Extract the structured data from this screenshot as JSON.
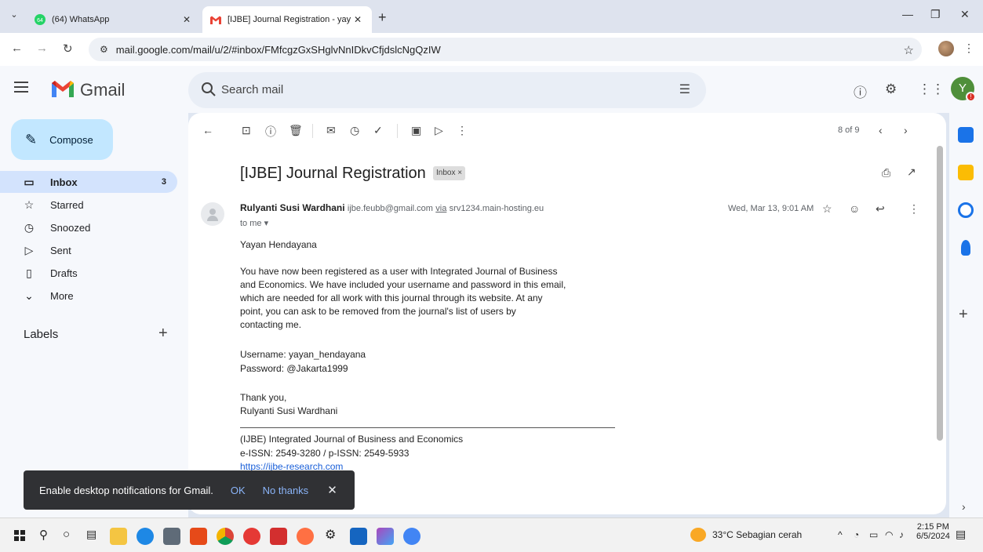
{
  "browser": {
    "tabs": [
      {
        "title": "(64) WhatsApp",
        "badge": "64",
        "active": false
      },
      {
        "title": "[IJBE] Journal Registration - yay",
        "active": true
      }
    ],
    "url_site_icon": "site-settings-icon",
    "url": "mail.google.com/mail/u/2/#inbox/FMfcgzGxSHglvNnIDkvCfjdslcNgQzIW"
  },
  "gmail": {
    "app_name": "Gmail",
    "search_placeholder": "Search mail",
    "avatar_letter": "Y",
    "compose_label": "Compose",
    "nav": [
      {
        "label": "Inbox",
        "count": "3",
        "icon": "inbox-icon"
      },
      {
        "label": "Starred",
        "count": "",
        "icon": "star-icon"
      },
      {
        "label": "Snoozed",
        "count": "",
        "icon": "clock-icon"
      },
      {
        "label": "Sent",
        "count": "",
        "icon": "send-icon"
      },
      {
        "label": "Drafts",
        "count": "",
        "icon": "draft-icon"
      },
      {
        "label": "More",
        "count": "",
        "icon": "chevron-down-icon"
      }
    ],
    "labels_title": "Labels",
    "pager": "8 of 9"
  },
  "email": {
    "subject": "[IJBE] Journal Registration",
    "label_chip": "Inbox",
    "sender_name": "Rulyanti Susi Wardhani",
    "sender_email": "ijbe.feubb@gmail.com",
    "via_word": "via",
    "via_host": "srv1234.main-hosting.eu",
    "to": "to me",
    "date": "Wed, Mar 13, 9:01 AM",
    "greeting": "Yayan Hendayana",
    "paragraph": [
      "You have now been registered as a user with Integrated Journal of Business",
      "and Economics. We have included your username and password in this email,",
      "which are needed for all work with this journal through its website. At any",
      "point, you can ask to be removed from the journal's list of users by",
      "contacting me."
    ],
    "username": "Username: yayan_hendayana",
    "password": "Password: @Jakarta1999",
    "thanks": "Thank you,",
    "signature": "Rulyanti Susi Wardhani",
    "journal_name": "(IJBE) Integrated Journal of Business and Economics",
    "issn": "e-ISSN: 2549-3280 / p-ISSN: 2549-5933",
    "journal_link": "https://ijbe-research.com"
  },
  "snackbar": {
    "message": "Enable desktop notifications for Gmail.",
    "ok": "OK",
    "no_thanks": "No thanks"
  },
  "taskbar": {
    "weather": "33°C  Sebagian cerah",
    "time": "2:15 PM",
    "date": "6/5/2024"
  },
  "colors": {
    "compose_bg": "#c2e7ff",
    "inbox_active": "#d3e3fd",
    "gmail_red": "#ea4335",
    "link": "#1a5fd8"
  }
}
